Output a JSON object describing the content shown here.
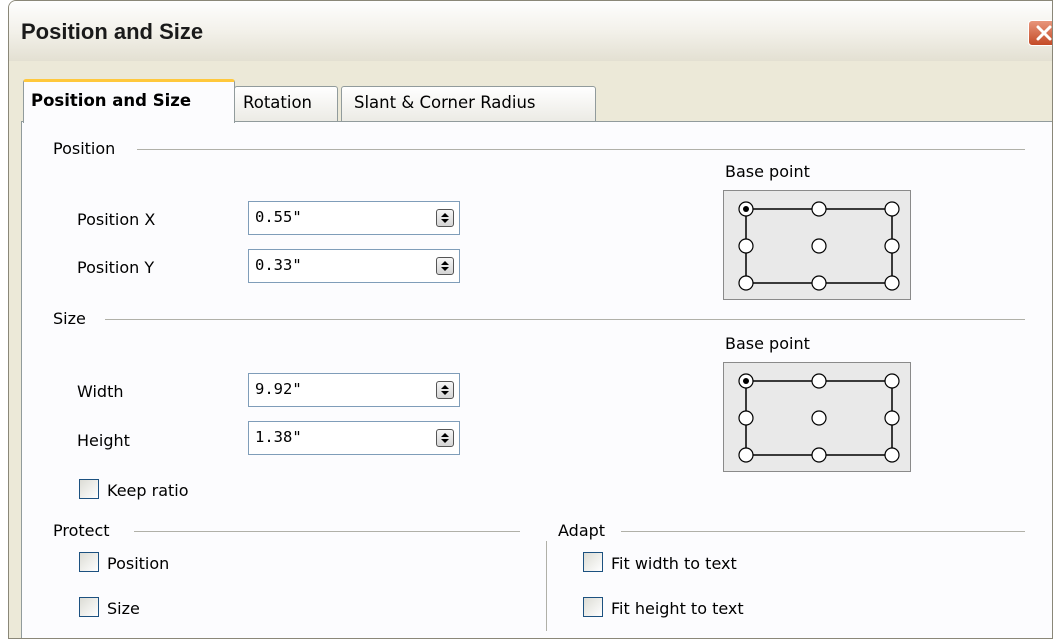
{
  "window": {
    "title": "Position and Size"
  },
  "tabs": [
    {
      "label": "Position and Size",
      "active": true
    },
    {
      "label": "Rotation",
      "active": false
    },
    {
      "label": "Slant & Corner Radius",
      "active": false
    }
  ],
  "position": {
    "heading": "Position",
    "x_label": "Position X",
    "x_value": "0.55\"",
    "y_label": "Position Y",
    "y_value": "0.33\"",
    "base_point_label": "Base point",
    "base_point_selected": "top-left"
  },
  "size": {
    "heading": "Size",
    "width_label": "Width",
    "width_value": "9.92\"",
    "height_label": "Height",
    "height_value": "1.38\"",
    "keep_ratio_label": "Keep ratio",
    "keep_ratio_checked": false,
    "base_point_label": "Base point",
    "base_point_selected": "top-left"
  },
  "protect": {
    "heading": "Protect",
    "position_label": "Position",
    "position_checked": false,
    "size_label": "Size",
    "size_checked": false
  },
  "adapt": {
    "heading": "Adapt",
    "fit_width_label": "Fit width to text",
    "fit_width_checked": false,
    "fit_height_label": "Fit height to text",
    "fit_height_checked": false
  },
  "colors": {
    "close_button": "#d4552f",
    "active_tab_highlight": "#ffc83c",
    "field_border": "#7f9db9"
  }
}
